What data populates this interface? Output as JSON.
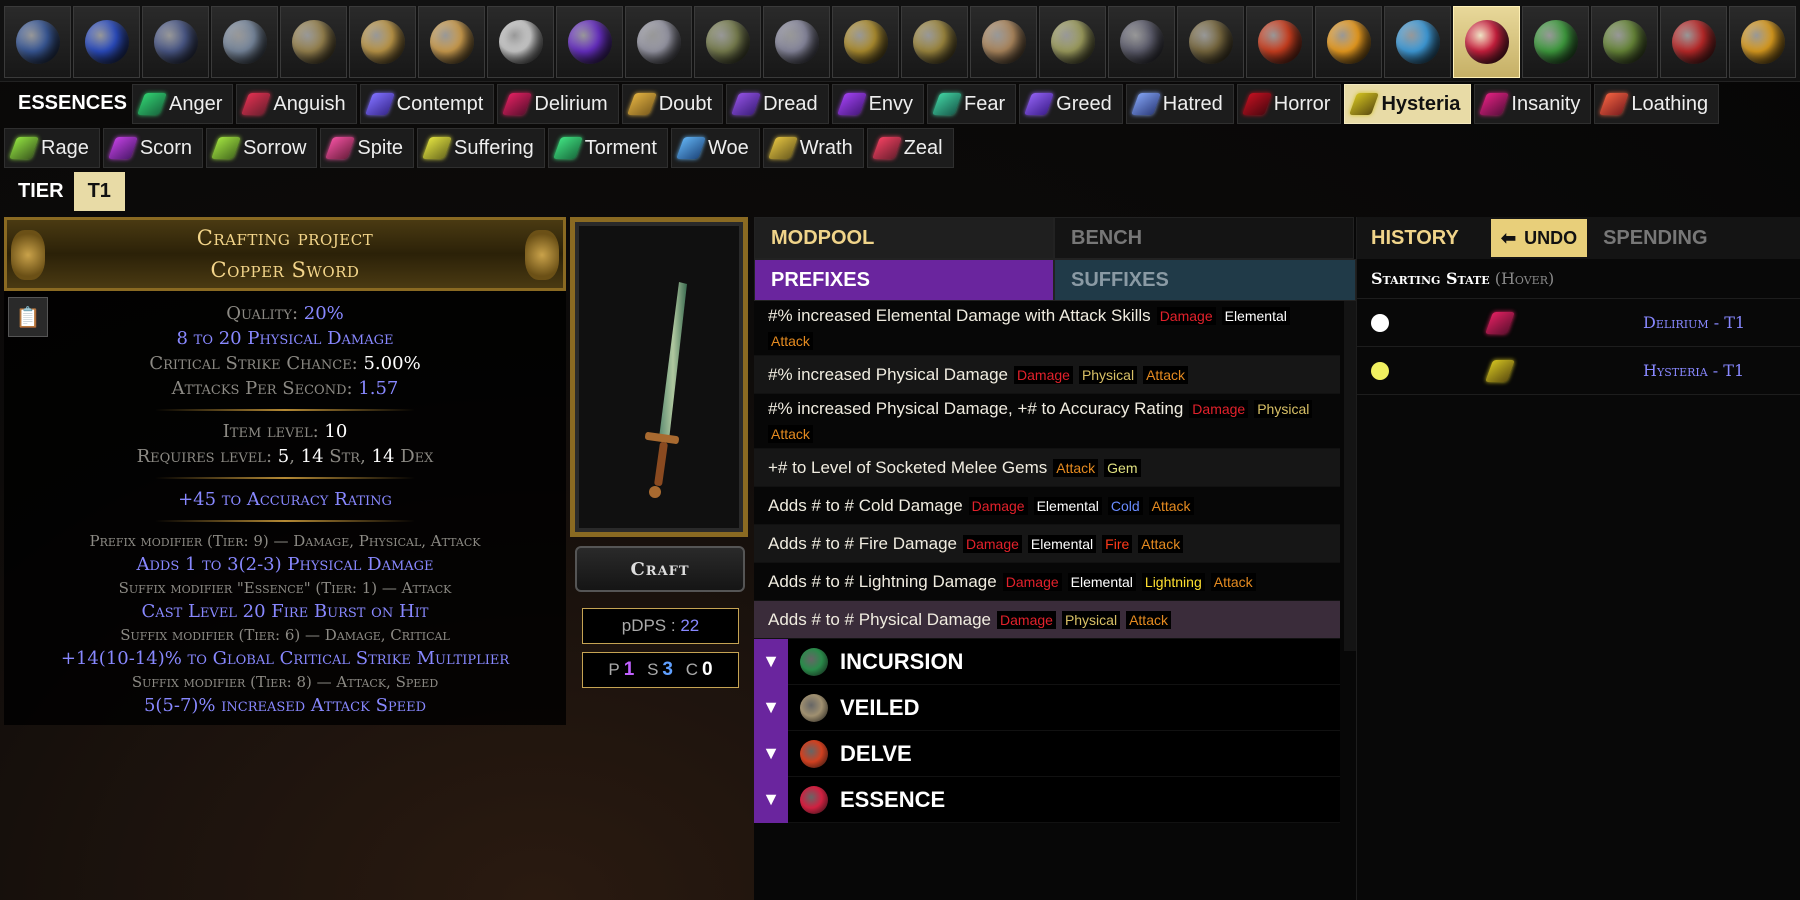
{
  "currency_bar": {
    "items": [
      {
        "name": "currency-icon-1",
        "color": "#3a5a9a"
      },
      {
        "name": "currency-icon-2",
        "color": "#2c4ec4"
      },
      {
        "name": "currency-icon-3",
        "color": "#4c5a8a"
      },
      {
        "name": "currency-icon-4",
        "color": "#7a8aa0"
      },
      {
        "name": "currency-icon-5",
        "color": "#9a8550"
      },
      {
        "name": "currency-icon-6",
        "color": "#c09a4a"
      },
      {
        "name": "currency-icon-7",
        "color": "#d0a050"
      },
      {
        "name": "currency-icon-8",
        "color": "#d0d0d0"
      },
      {
        "name": "currency-icon-9",
        "color": "#6a30c8"
      },
      {
        "name": "currency-icon-10",
        "color": "#9a9aa8"
      },
      {
        "name": "currency-icon-11",
        "color": "#7a8050"
      },
      {
        "name": "currency-icon-12",
        "color": "#8a8aa0"
      },
      {
        "name": "currency-icon-13",
        "color": "#b09030"
      },
      {
        "name": "currency-icon-14",
        "color": "#a08a40"
      },
      {
        "name": "currency-icon-15",
        "color": "#b08a60"
      },
      {
        "name": "currency-icon-16",
        "color": "#a0a060"
      },
      {
        "name": "currency-icon-17",
        "color": "#606070"
      },
      {
        "name": "currency-icon-18",
        "color": "#7a6a40"
      },
      {
        "name": "currency-icon-19",
        "color": "#d04020"
      },
      {
        "name": "currency-icon-20",
        "color": "#f0a020"
      },
      {
        "name": "currency-icon-21",
        "color": "#40a0e0"
      },
      {
        "name": "currency-icon-22",
        "color": "#d02040",
        "selected": true
      },
      {
        "name": "currency-icon-23",
        "color": "#40a040"
      },
      {
        "name": "currency-icon-24",
        "color": "#6a8a3a"
      },
      {
        "name": "currency-icon-25",
        "color": "#c02a2a"
      },
      {
        "name": "currency-icon-26",
        "color": "#e0a020"
      }
    ]
  },
  "essences": {
    "title": "ESSENCES",
    "row1": [
      {
        "label": "Anger",
        "c1": "#30d070",
        "c2": "#1a6a40"
      },
      {
        "label": "Anguish",
        "c1": "#e03050",
        "c2": "#702030"
      },
      {
        "label": "Contempt",
        "c1": "#8070ff",
        "c2": "#3a2a90"
      },
      {
        "label": "Delirium",
        "c1": "#e02060",
        "c2": "#601030"
      },
      {
        "label": "Doubt",
        "c1": "#e0b040",
        "c2": "#806020"
      },
      {
        "label": "Dread",
        "c1": "#9050e0",
        "c2": "#402080"
      },
      {
        "label": "Envy",
        "c1": "#a040f0",
        "c2": "#4a1a80"
      },
      {
        "label": "Fear",
        "c1": "#40d0a0",
        "c2": "#1a6050"
      },
      {
        "label": "Greed",
        "c1": "#9060f0",
        "c2": "#402090"
      },
      {
        "label": "Hatred",
        "c1": "#80a0f0",
        "c2": "#304080"
      },
      {
        "label": "Horror",
        "c1": "#c01020",
        "c2": "#500810"
      },
      {
        "label": "Hysteria",
        "c1": "#d0c020",
        "c2": "#605010",
        "selected": true
      },
      {
        "label": "Insanity",
        "c1": "#e02080",
        "c2": "#601040"
      },
      {
        "label": "Loathing",
        "c1": "#f06040",
        "c2": "#802020"
      }
    ],
    "row2": [
      {
        "label": "Rage",
        "c1": "#90e040",
        "c2": "#406020"
      },
      {
        "label": "Scorn",
        "c1": "#c040e0",
        "c2": "#501a70"
      },
      {
        "label": "Sorrow",
        "c1": "#a0e040",
        "c2": "#4a7020"
      },
      {
        "label": "Spite",
        "c1": "#f050a0",
        "c2": "#702040"
      },
      {
        "label": "Suffering",
        "c1": "#e0e040",
        "c2": "#707020"
      },
      {
        "label": "Torment",
        "c1": "#40e080",
        "c2": "#1a7040"
      },
      {
        "label": "Woe",
        "c1": "#60b0f0",
        "c2": "#204a80"
      },
      {
        "label": "Wrath",
        "c1": "#e0c040",
        "c2": "#706020"
      },
      {
        "label": "Zeal",
        "c1": "#f04060",
        "c2": "#702030"
      }
    ]
  },
  "tier": {
    "label": "TIER",
    "value": "T1"
  },
  "item": {
    "header_line1": "Crafting project",
    "header_line2": "Copper Sword",
    "clipboard_icon": "clipboard-icon",
    "quality_label": "Quality:",
    "quality_value": "20%",
    "damage_line": "8 to 20 Physical Damage",
    "crit_label": "Critical Strike Chance:",
    "crit_value": "5.00%",
    "aps_label": "Attacks Per Second:",
    "aps_value": "1.57",
    "ilvl_label": "Item level:",
    "ilvl_value": "10",
    "req_label": "Requires level:",
    "req_lvl": "5",
    "req_str": "14",
    "req_str_lbl": "Str",
    "req_dex": "14",
    "req_dex_lbl": "Dex",
    "implicit": "+45 to Accuracy Rating",
    "mods": [
      {
        "header": "Prefix modifier (Tier: 9) — Damage, Physical, Attack",
        "text": "Adds 1 to 3(2-3) Physical Damage"
      },
      {
        "header": "Suffix modifier \"Essence\" (Tier: 1) — Attack",
        "text": "Cast Level 20 Fire Burst on Hit"
      },
      {
        "header": "Suffix modifier (Tier: 6) — Damage, Critical",
        "text": "+14(10-14)% to Global Critical Strike Multiplier"
      },
      {
        "header": "Suffix modifier (Tier: 8) — Attack, Speed",
        "text": "5(5-7)% increased Attack Speed"
      }
    ]
  },
  "craft": {
    "button": "Craft",
    "pdps_label": "pDPS :",
    "pdps_value": "22",
    "p_label": "P",
    "p_value": "1",
    "s_label": "S",
    "s_value": "3",
    "c_label": "C",
    "c_value": "0"
  },
  "modpool": {
    "tab_modpool": "MODPOOL",
    "tab_bench": "BENCH",
    "tab_prefixes": "PREFIXES",
    "tab_suffixes": "SUFFIXES",
    "mods": [
      {
        "text": "#% increased Elemental Damage with Attack Skills",
        "tags": [
          "Damage",
          "Elemental",
          "Attack"
        ]
      },
      {
        "text": "#% increased Physical Damage",
        "tags": [
          "Damage",
          "Physical",
          "Attack"
        ]
      },
      {
        "text": "#% increased Physical Damage, +# to Accuracy Rating",
        "tags": [
          "Damage",
          "Physical",
          "Attack"
        ]
      },
      {
        "text": "+# to Level of Socketed Melee Gems",
        "tags": [
          "Attack",
          "Gem"
        ]
      },
      {
        "text": "Adds # to # Cold Damage",
        "tags": [
          "Damage",
          "Elemental",
          "Cold",
          "Attack"
        ]
      },
      {
        "text": "Adds # to # Fire Damage",
        "tags": [
          "Damage",
          "Elemental",
          "Fire",
          "Attack"
        ]
      },
      {
        "text": "Adds # to # Lightning Damage",
        "tags": [
          "Damage",
          "Elemental",
          "Lightning",
          "Attack"
        ]
      },
      {
        "text": "Adds # to # Physical Damage",
        "tags": [
          "Damage",
          "Physical",
          "Attack"
        ],
        "highlighted": true
      }
    ],
    "sections": [
      {
        "label": "INCURSION",
        "color": "#2a8a4a"
      },
      {
        "label": "VEILED",
        "color": "#a09070"
      },
      {
        "label": "DELVE",
        "color": "#d04020"
      },
      {
        "label": "ESSENCE",
        "color": "#d02040"
      }
    ]
  },
  "history": {
    "tab_history": "HISTORY",
    "undo": "UNDO",
    "tab_spending": "SPENDING",
    "starting_state": "Starting State",
    "starting_hint": "(Hover)",
    "rows": [
      {
        "dot": "#ffffff",
        "label": "Delirium - T1",
        "c1": "#e02060",
        "c2": "#601030"
      },
      {
        "dot": "#f0f060",
        "label": "Hysteria - T1",
        "c1": "#d0c020",
        "c2": "#605010"
      }
    ]
  }
}
